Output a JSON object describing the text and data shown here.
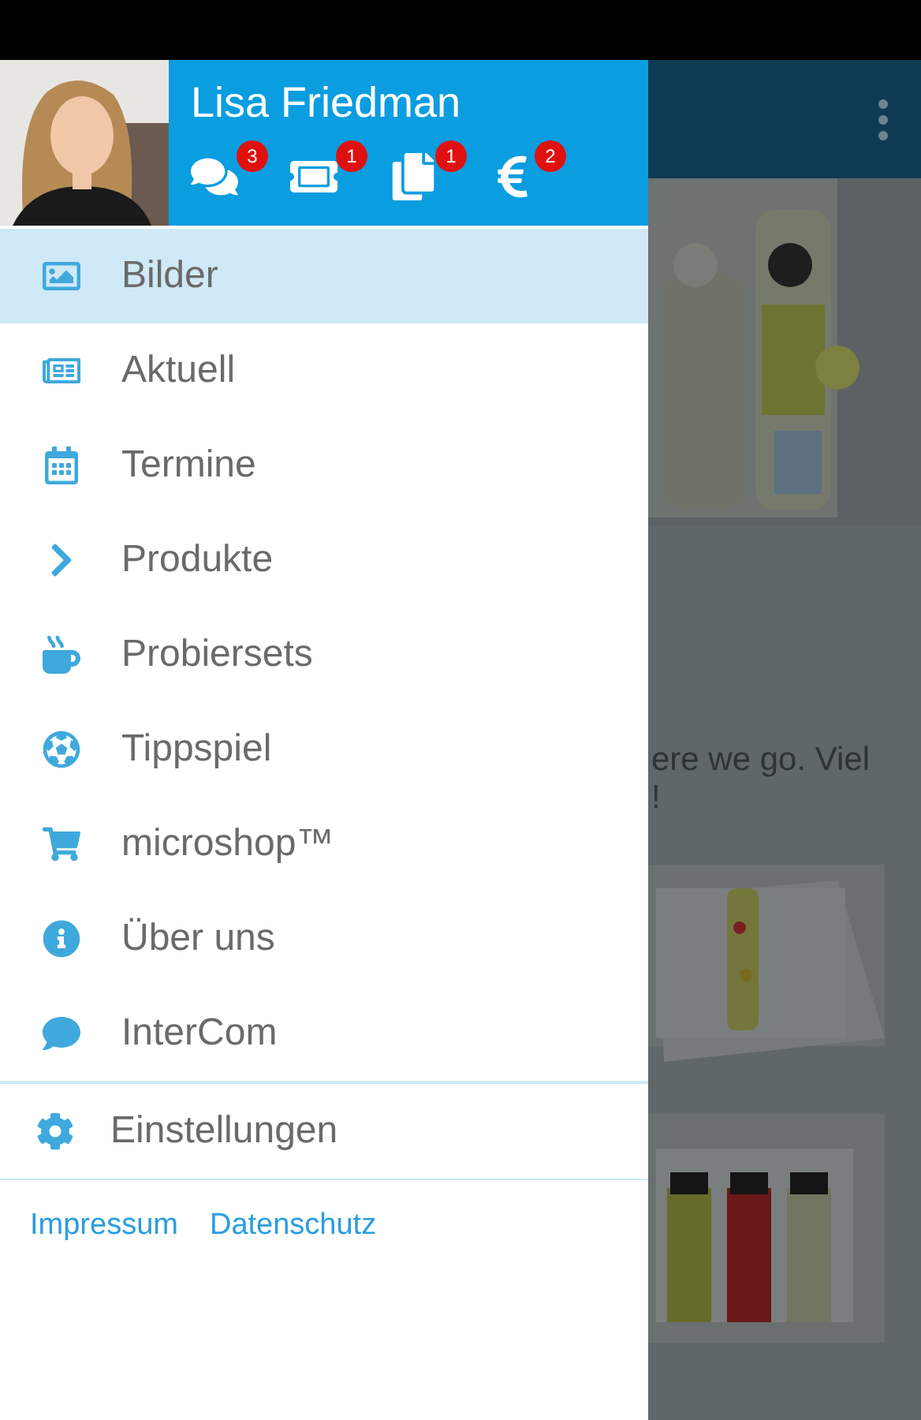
{
  "drawer": {
    "user_name": "Lisa Friedman",
    "counters": [
      {
        "count": "3"
      },
      {
        "count": "1"
      },
      {
        "count": "1"
      },
      {
        "count": "2"
      }
    ],
    "menu": [
      {
        "label": "Bilder",
        "selected": true
      },
      {
        "label": "Aktuell",
        "selected": false
      },
      {
        "label": "Termine",
        "selected": false
      },
      {
        "label": "Produkte",
        "selected": false
      },
      {
        "label": "Probiersets",
        "selected": false
      },
      {
        "label": "Tippspiel",
        "selected": false
      },
      {
        "label": "microshop™",
        "selected": false
      },
      {
        "label": "Über uns",
        "selected": false
      },
      {
        "label": "InterCom",
        "selected": false
      }
    ],
    "settings": "Einstellungen",
    "links": [
      "Impressum",
      "Datenschutz"
    ]
  },
  "background": {
    "text_lines": [
      "ere we go. Viel",
      "!"
    ]
  }
}
